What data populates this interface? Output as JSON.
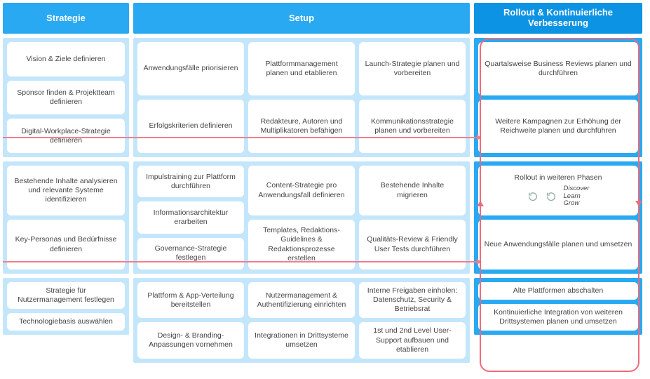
{
  "headers": {
    "strategy": "Strategie",
    "setup": "Setup",
    "rollout": "Rollout & Kontinuierliche Verbesserung"
  },
  "strategy": {
    "r1": [
      "Vision & Ziele definieren",
      "Sponsor finden & Projektteam definieren",
      "Digital-Workplace-Strategie definieren"
    ],
    "r2": [
      "Bestehende Inhalte analysieren und relevante Systeme identifizieren",
      "Key-Personas und Bedürfnisse definieren"
    ],
    "r3": [
      "Strategie für Nutzermanagement festlegen",
      "Technologiebasis auswählen"
    ]
  },
  "setup": {
    "r1": [
      "Anwendungsfälle priorisieren",
      "Plattformmanagement planen und etablieren",
      "Launch-Strategie planen und vorbereiten",
      "Erfolgskriterien definieren",
      "Redakteure, Autoren und Multiplikatoren befähigen",
      "Kommunikations­strategie planen und vorbereiten"
    ],
    "r2_left": [
      "Impulstraining zur Plattform durchführen",
      "Informationsarchitektur erarbeiten",
      "Governance-Strategie festlegen"
    ],
    "r2_mid": [
      "Content-Strategie pro Anwendungsfall definieren",
      "Templates, Redaktions-Guidelines & Redaktionsprozesse erstellen"
    ],
    "r2_right": [
      "Bestehende Inhalte migrieren",
      "Qualitäts-Review & Friendly User Tests durchführen"
    ],
    "r3": [
      "Plattform & App-Verteilung bereitstellen",
      "Nutzermanagement & Authentifizierung einrichten",
      "Interne Freigaben einholen: Datenschutz, Security & Betriebsrat",
      "Design- & Branding-Anpassungen vornehmen",
      "Integrationen in Drittsysteme umsetzen",
      "1st und 2nd Level User-Support aufbauen und etablieren"
    ]
  },
  "rollout": {
    "r1": [
      "Quartalsweise Business Reviews planen und durchführen",
      "Weitere Kampagnen zur Erhöhung der Reichweite planen und durchführen"
    ],
    "r2_phase_title": "Rollout in weiteren Phasen",
    "r2_phase_words": [
      "Discover",
      "Learn",
      "Grow"
    ],
    "r2_b": "Neue Anwendungsfälle planen und umsetzen",
    "r3": [
      "Alte Plattformen abschalten",
      "Kontinuierliche Integration von weiteren Drittsystemen planen und umsetzen"
    ]
  }
}
